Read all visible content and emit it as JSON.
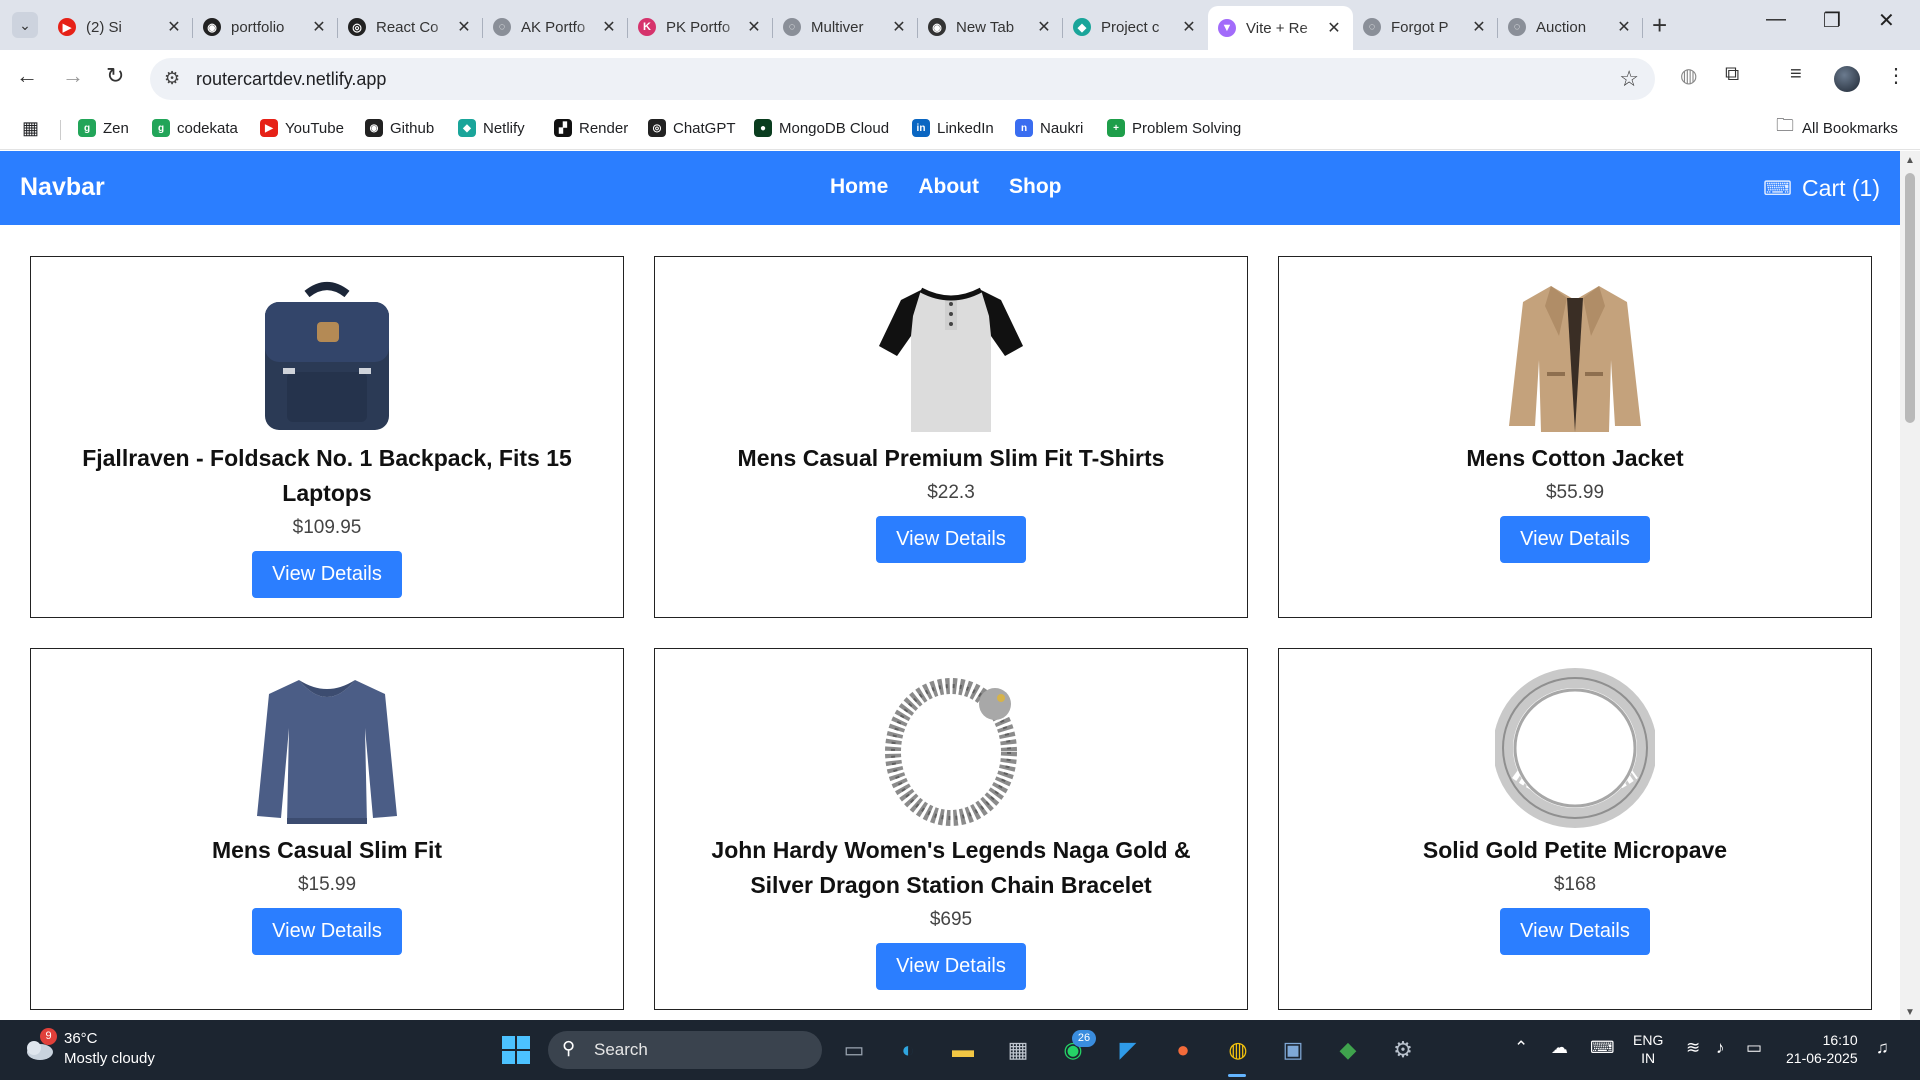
{
  "browser": {
    "tabs": [
      {
        "title": "(2) Si",
        "color": "#e62117",
        "glyph": "▶"
      },
      {
        "title": "portfolio",
        "color": "#222222",
        "glyph": "◉"
      },
      {
        "title": "React Co",
        "color": "#222222",
        "glyph": "◎"
      },
      {
        "title": "AK Portfo",
        "color": "#8a8f98",
        "glyph": "◌"
      },
      {
        "title": "PK Portfo",
        "color": "#d6336c",
        "glyph": "K"
      },
      {
        "title": "Multiver",
        "color": "#8a8f98",
        "glyph": "◌"
      },
      {
        "title": "New Tab",
        "color": "#333333",
        "glyph": "◉"
      },
      {
        "title": "Project c",
        "color": "#1aa59a",
        "glyph": "◆"
      },
      {
        "title": "Vite + Re",
        "color": "#a26bfa",
        "glyph": "▼"
      },
      {
        "title": "Forgot P",
        "color": "#8a8f98",
        "glyph": "◌"
      },
      {
        "title": "Auction",
        "color": "#8a8f98",
        "glyph": "◌"
      }
    ],
    "url": "routercartdev.netlify.app",
    "bookmarks": [
      {
        "label": "Zen",
        "color": "#22a559",
        "glyph": "g"
      },
      {
        "label": "codekata",
        "color": "#22a559",
        "glyph": "g"
      },
      {
        "label": "YouTube",
        "color": "#e62117",
        "glyph": "▶"
      },
      {
        "label": "Github",
        "color": "#222222",
        "glyph": "◉"
      },
      {
        "label": "Netlify",
        "color": "#1aa59a",
        "glyph": "◆"
      },
      {
        "label": "Render",
        "color": "#111111",
        "glyph": "▞"
      },
      {
        "label": "ChatGPT",
        "color": "#222222",
        "glyph": "◎"
      },
      {
        "label": "MongoDB Cloud",
        "color": "#0a3d1f",
        "glyph": "●"
      },
      {
        "label": "LinkedIn",
        "color": "#0a66c2",
        "glyph": "in"
      },
      {
        "label": "Naukri",
        "color": "#3a6df0",
        "glyph": "n"
      },
      {
        "label": "Problem Solving",
        "color": "#1e9e4a",
        "glyph": "+"
      }
    ],
    "all_bookmarks": "All Bookmarks"
  },
  "app": {
    "brand": "Navbar",
    "nav": {
      "home": "Home",
      "about": "About",
      "shop": "Shop"
    },
    "cart_label": "Cart (1)",
    "view_details_label": "View Details",
    "products": [
      {
        "name": "Fjallraven - Foldsack No. 1 Backpack, Fits 15 Laptops",
        "price": "$109.95",
        "image": "backpack"
      },
      {
        "name": "Mens Casual Premium Slim Fit T-Shirts",
        "price": "$22.3",
        "image": "tshirt"
      },
      {
        "name": "Mens Cotton Jacket",
        "price": "$55.99",
        "image": "jacket"
      },
      {
        "name": "Mens Casual Slim Fit",
        "price": "$15.99",
        "image": "sweater"
      },
      {
        "name": "John Hardy Women's Legends Naga Gold & Silver Dragon Station Chain Bracelet",
        "price": "$695",
        "image": "bracelet"
      },
      {
        "name": "Solid Gold Petite Micropave",
        "price": "$168",
        "image": "ring"
      }
    ],
    "accent": "#2b7eff"
  },
  "taskbar": {
    "weather_badge": "9",
    "temperature": "36°C",
    "condition": "Mostly cloudy",
    "search_label": "Search",
    "whatsapp_badge": "26",
    "lang_line1": "ENG",
    "lang_line2": "IN",
    "time": "16:10",
    "date": "21-06-2025"
  }
}
